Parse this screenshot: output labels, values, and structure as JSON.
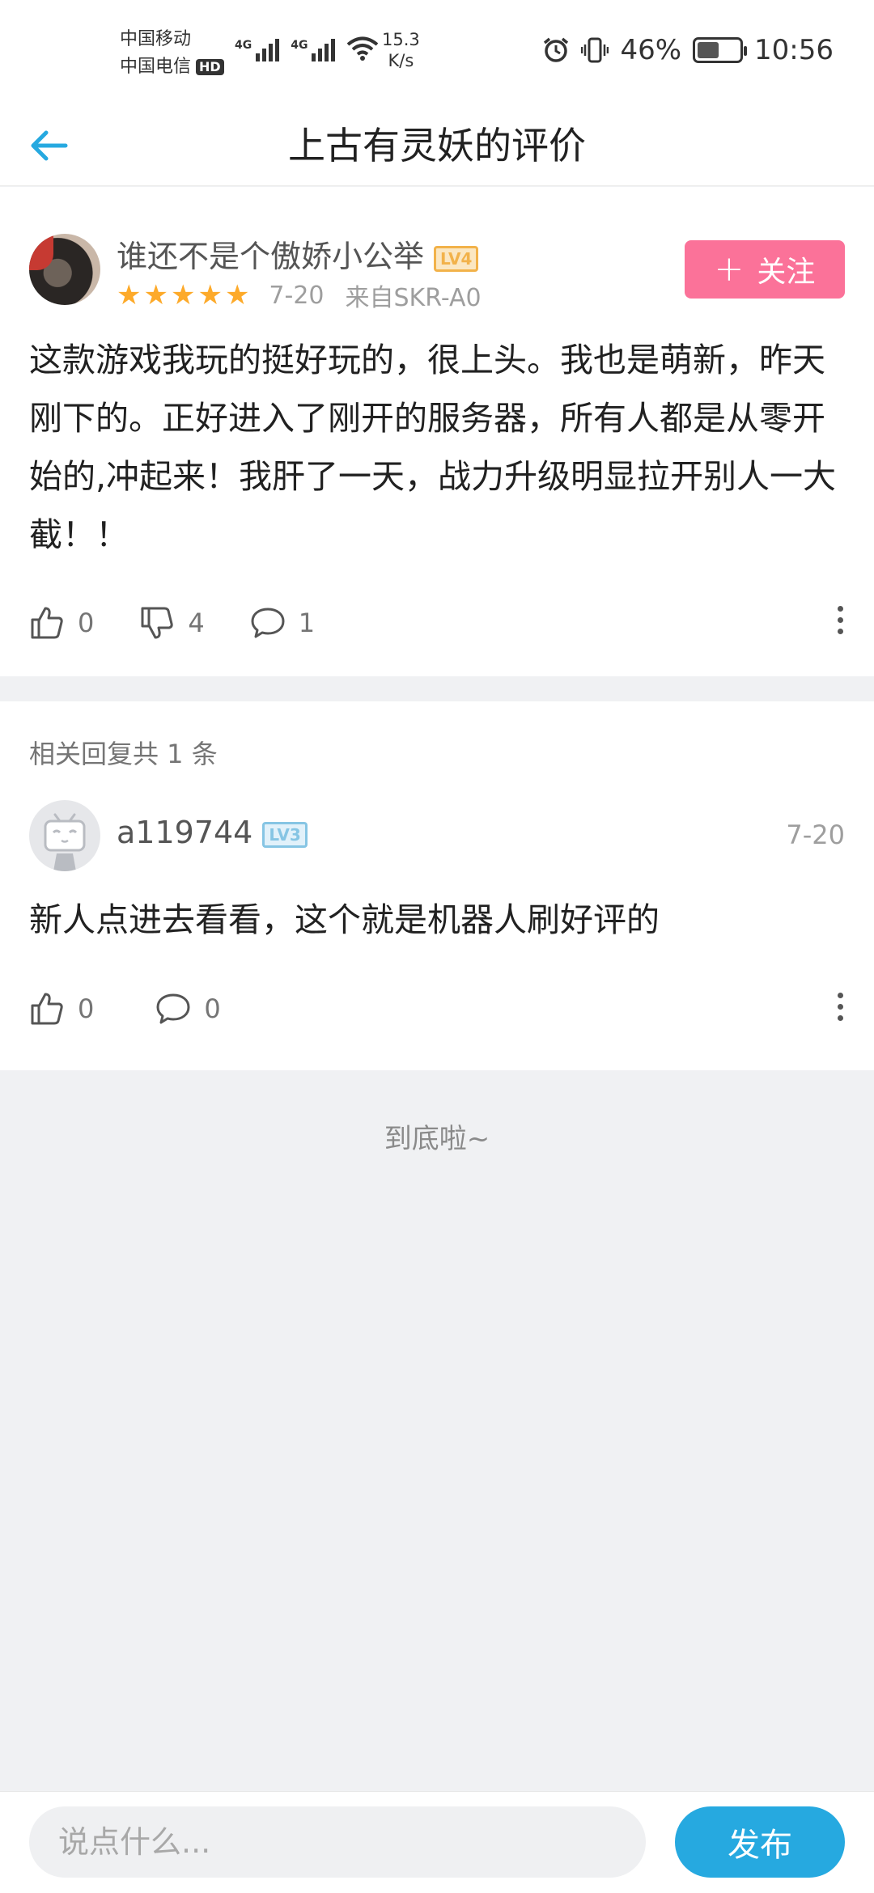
{
  "status_bar": {
    "carrier_1": "中国移动",
    "carrier_2": "中国电信",
    "hd_label": "HD",
    "network_1": "4G",
    "network_2": "4G",
    "speed_value": "15.3",
    "speed_unit": "K/s",
    "battery": "46%",
    "time": "10:56"
  },
  "header": {
    "title": "上古有灵妖的评价"
  },
  "review": {
    "username": "谁还不是个傲娇小公举",
    "level": "LV4",
    "rating": 5,
    "date": "7-20",
    "device": "来自SKR-A0",
    "follow_label": "关注",
    "body": "这款游戏我玩的挺好玩的，很上头。我也是萌新，昨天刚下的。正好进入了刚开的服务器，所有人都是从零开始的,冲起来！我肝了一天，战力升级明显拉开别人一大截！！",
    "likes": "0",
    "dislikes": "4",
    "comments": "1"
  },
  "replies": {
    "count_label": "相关回复共 1 条",
    "items": [
      {
        "username": "a119744",
        "level": "LV3",
        "date": "7-20",
        "body": "新人点进去看看，这个就是机器人刷好评的",
        "likes": "0",
        "comments": "0"
      }
    ]
  },
  "end_note": "到底啦~",
  "composer": {
    "placeholder": "说点什么...",
    "publish_label": "发布"
  },
  "colors": {
    "accent_blue": "#26a9e0",
    "follow_pink": "#fb7299",
    "star_orange": "#fdaa2a"
  }
}
